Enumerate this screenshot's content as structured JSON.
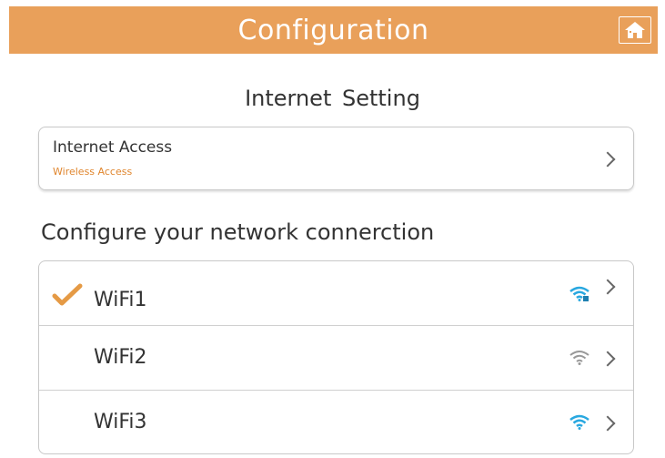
{
  "header": {
    "title": "Configuration",
    "home_icon": "home-icon",
    "bg_color": "#e9a05a"
  },
  "internet_setting": {
    "title": "Internet  Setting",
    "access": {
      "label": "Internet Access",
      "value": "Wireless Access",
      "value_color": "#e0862e"
    }
  },
  "network": {
    "heading": "Configure your network connerction",
    "items": [
      {
        "name": "WiFi1",
        "selected": true,
        "signal_icon": "wifi-signal-icon",
        "signal_color": "#29a8e0"
      },
      {
        "name": "WiFi2",
        "selected": false,
        "signal_icon": "wifi-signal-icon",
        "signal_color": "#999999"
      },
      {
        "name": "WiFi3",
        "selected": false,
        "signal_icon": "wifi-signal-icon",
        "signal_color": "#29a8e0"
      }
    ]
  }
}
